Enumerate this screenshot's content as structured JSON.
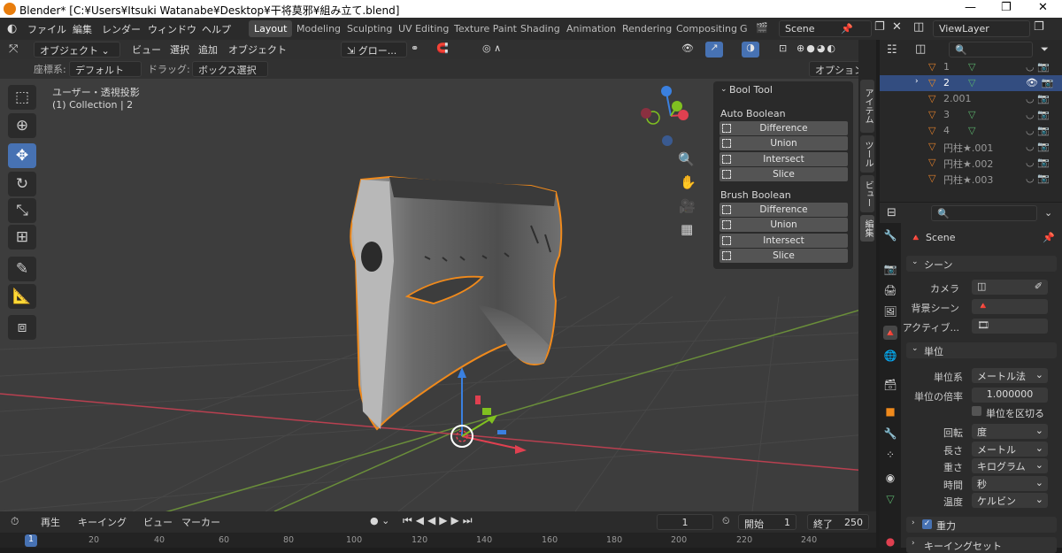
{
  "window": {
    "title": "Blender* [C:¥Users¥Itsuki Watanabe¥Desktop¥干将莫邪¥組み立て.blend]"
  },
  "menus": [
    "ファイル",
    "編集",
    "レンダー",
    "ウィンドウ",
    "ヘルプ"
  ],
  "workspaces": [
    "Layout",
    "Modeling",
    "Sculpting",
    "UV Editing",
    "Texture Paint",
    "Shading",
    "Animation",
    "Rendering",
    "Compositing",
    "G"
  ],
  "scene": "Scene",
  "viewlayer": "ViewLayer",
  "viewport": {
    "mode": "オブジェクト",
    "menu": [
      "ビュー",
      "選択",
      "追加",
      "オブジェクト"
    ],
    "transform": "グロー...",
    "coord_label": "座標系:",
    "coord_value": "デフォルト",
    "drag_label": "ドラッグ:",
    "drag_value": "ボックス選択",
    "options": "オプション",
    "view_title": "ユーザー・透視投影",
    "collection": "(1) Collection | 2"
  },
  "boolpanel": {
    "title": "Bool Tool",
    "auto_title": "Auto Boolean",
    "auto": [
      "Difference",
      "Union",
      "Intersect",
      "Slice"
    ],
    "brush_title": "Brush Boolean",
    "brush": [
      "Difference",
      "Union",
      "Intersect",
      "Slice"
    ]
  },
  "sidetabs": [
    "アイテム",
    "ツール",
    "ビュー",
    "編集"
  ],
  "outliner": {
    "items": [
      "1",
      "2",
      "2.001",
      "3",
      "4",
      "円柱★.001",
      "円柱★.002",
      "円柱★.003"
    ],
    "selected": "2"
  },
  "props": {
    "scene_label": "Scene",
    "scene_section": "シーン",
    "camera": "カメラ",
    "bgscene": "背景シーン",
    "active": "アクティブ...",
    "units": "単位",
    "unit_system_l": "単位系",
    "unit_system": "メートル法",
    "scale_l": "単位の倍率",
    "scale": "1.000000",
    "separate": "単位を区切る",
    "rot_l": "回転",
    "rot": "度",
    "len_l": "長さ",
    "len": "メートル",
    "mass_l": "重さ",
    "mass": "キログラム",
    "time_l": "時間",
    "time": "秒",
    "temp_l": "温度",
    "temp": "ケルビン",
    "gravity": "重力",
    "keying": "キーイングセット"
  },
  "timeline": {
    "play": "再生",
    "keying": "キーイング",
    "view": "ビュー",
    "marker": "マーカー",
    "current": "1",
    "start_l": "開始",
    "start": "1",
    "end_l": "終了",
    "end": "250",
    "ticks": [
      "1",
      "20",
      "40",
      "60",
      "80",
      "100",
      "120",
      "140",
      "160",
      "180",
      "200",
      "220",
      "240"
    ]
  },
  "colors": {
    "accent": "#4772b3",
    "selection": "#f08a1c",
    "x_axis": "#e04050",
    "y_axis": "#80c020",
    "z_axis": "#3a80e0"
  }
}
